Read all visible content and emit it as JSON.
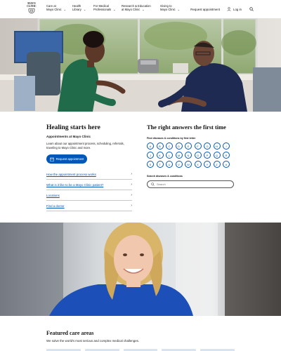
{
  "brand": {
    "logo_line1": "MAYO",
    "logo_line2": "CLINIC"
  },
  "nav": {
    "items": [
      {
        "line1": "Care at",
        "line2": "Mayo Clinic"
      },
      {
        "line1": "Health",
        "line2": "Library"
      },
      {
        "line1": "For Medical",
        "line2": "Professionals"
      },
      {
        "line1": "Research & Education",
        "line2": "at Mayo Clinic"
      },
      {
        "line1": "Giving to",
        "line2": "Mayo Clinic"
      }
    ],
    "request_appointment": "Request appointment",
    "login": "Log in"
  },
  "healing": {
    "title": "Healing starts here",
    "subtitle": "Appointments at Mayo Clinic",
    "description": "Learn about our appointment process, scheduling, referrals, traveling to Mayo Clinic and more.",
    "button": "Request appointment",
    "links": [
      "How the appointment process works",
      "What is it like to be a Mayo Clinic patient?",
      "Locations",
      "Find a doctor"
    ]
  },
  "answers": {
    "title": "The right answers the first time",
    "letters_label": "Find diseases & conditions by first letter",
    "letters": [
      "A",
      "B",
      "C",
      "D",
      "E",
      "F",
      "G",
      "H",
      "I",
      "J",
      "K",
      "L",
      "M",
      "N",
      "O",
      "P",
      "Q",
      "R",
      "S",
      "T",
      "U",
      "V",
      "W",
      "X",
      "Y",
      "Z",
      "#"
    ],
    "search_label": "Search diseases & conditions",
    "search_placeholder": "Search"
  },
  "featured": {
    "title": "Featured care areas",
    "subtitle": "We solve the world's most serious and complex medical challenges."
  },
  "colors": {
    "accent": "#0057b8",
    "text": "#1a1a1a"
  }
}
